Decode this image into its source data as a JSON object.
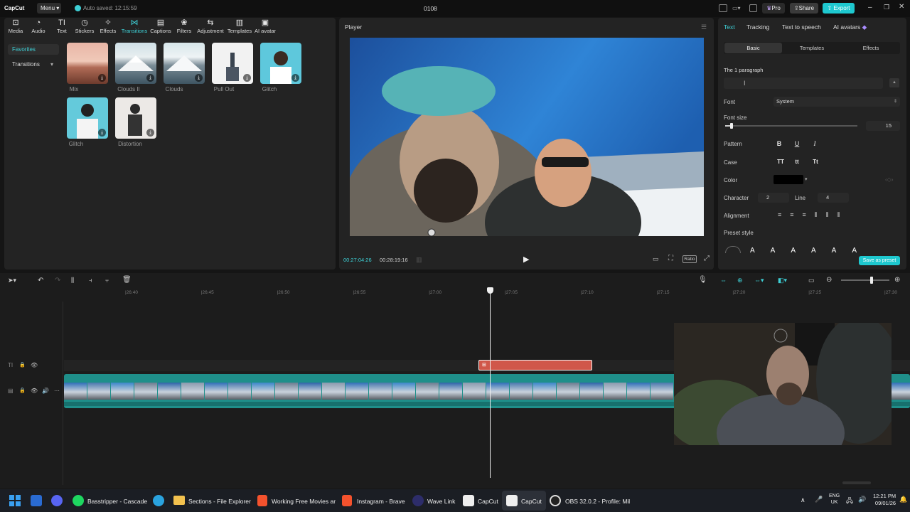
{
  "titlebar": {
    "logo": "CapCut",
    "menu": "Menu",
    "autosave": "Auto saved: 12:15:59",
    "project": "0108",
    "pro": "Pro",
    "share": "Share",
    "export": "Export"
  },
  "toolbar": [
    {
      "label": "Media",
      "icon": "media-icon"
    },
    {
      "label": "Audio",
      "icon": "audio-icon"
    },
    {
      "label": "Text",
      "icon": "text-icon"
    },
    {
      "label": "Stickers",
      "icon": "stickers-icon"
    },
    {
      "label": "Effects",
      "icon": "effects-icon"
    },
    {
      "label": "Transitions",
      "icon": "transitions-icon",
      "active": true
    },
    {
      "label": "Captions",
      "icon": "captions-icon"
    },
    {
      "label": "Filters",
      "icon": "filters-icon"
    },
    {
      "label": "Adjustment",
      "icon": "adjustment-icon"
    },
    {
      "label": "Templates",
      "icon": "templates-icon"
    },
    {
      "label": "AI avatar",
      "icon": "ai-avatar-icon"
    }
  ],
  "sidebar": {
    "favorites": "Favorites",
    "transitions": "Transitions"
  },
  "transitions": [
    {
      "label": "Mix"
    },
    {
      "label": "Clouds II"
    },
    {
      "label": "Clouds"
    },
    {
      "label": "Pull Out"
    },
    {
      "label": "Glitch"
    },
    {
      "label": "Glitch"
    },
    {
      "label": "Distortion"
    }
  ],
  "player": {
    "title": "Player",
    "current_time": "00:27:04:26",
    "total_time": "00:28:19:16",
    "ratio": "Ratio"
  },
  "right_panel": {
    "tabs": [
      "Text",
      "Tracking",
      "Text to speech",
      "AI avatars"
    ],
    "subtabs": [
      "Basic",
      "Templates",
      "Effects"
    ],
    "paragraph_label": "The 1 paragraph",
    "font_label": "Font",
    "font_value": "System",
    "font_size_label": "Font size",
    "font_size_value": "15",
    "font_size_fraction": 0.05,
    "pattern_label": "Pattern",
    "pattern_buttons": [
      "B",
      "U",
      "I"
    ],
    "case_label": "Case",
    "case_buttons": [
      "TT",
      "tt",
      "Tt"
    ],
    "color_label": "Color",
    "color_value": "#000000",
    "character_label": "Character",
    "character_value": "2",
    "line_label": "Line",
    "line_value": "4",
    "alignment_label": "Alignment",
    "preset_label": "Preset style",
    "save_preset": "Save as preset"
  },
  "timeline": {
    "ticks": [
      "|26:40",
      "|26:45",
      "|26:50",
      "|26:55",
      "|27:00",
      "|27:05",
      "|27:10",
      "|27:15",
      "|27:20",
      "|27:25",
      "|27:30"
    ],
    "zoom_fraction": 0.6
  },
  "taskbar": {
    "items": [
      "Basstripper - Cascade",
      "Sections - File Explorer",
      "Working Free Movies ar",
      "Instagram - Brave",
      "Wave Link",
      "CapCut",
      "CapCut",
      "OBS 32.0.2 - Profile: Mil"
    ],
    "lang1": "ENG",
    "lang2": "UK",
    "time": "12:21 PM",
    "date": "09/01/26"
  },
  "colors": {
    "accent": "#3ed0d6",
    "text_clip": "#d0574a",
    "video_track": "#1f8f8a",
    "export": "#1ec8cf"
  }
}
